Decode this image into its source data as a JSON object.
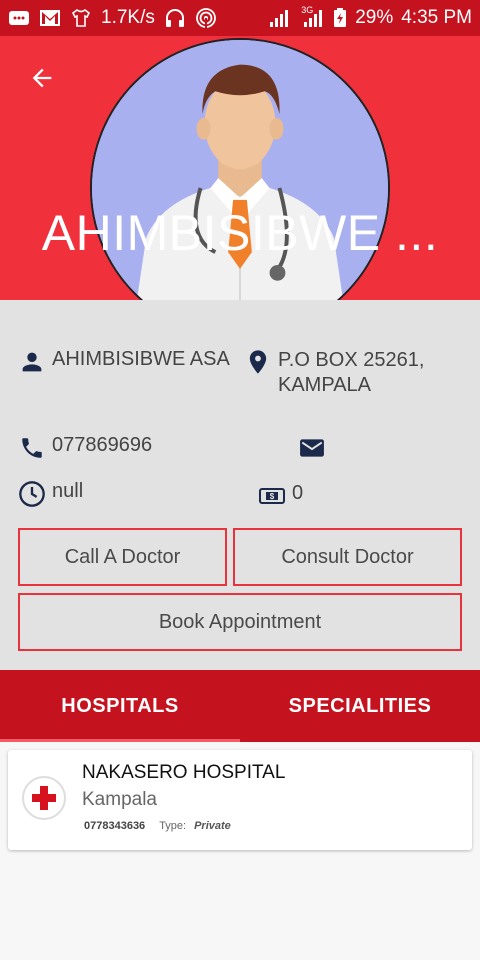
{
  "status_bar": {
    "speed": "1.7K/s",
    "network": "3G",
    "battery": "29%",
    "time": "4:35 PM"
  },
  "header": {
    "title": "AHIMBISIBWE ..."
  },
  "doctor": {
    "name": "AHIMBISIBWE ASA",
    "address_line1": "P.O BOX 25261,",
    "address_line2": "KAMPALA",
    "phone": "077869696",
    "hours": "null",
    "fee": "0"
  },
  "actions": {
    "call": "Call A Doctor",
    "consult": "Consult Doctor",
    "book": "Book Appointment"
  },
  "tabs": [
    {
      "label": "HOSPITALS",
      "active": true
    },
    {
      "label": "SPECIALITIES",
      "active": false
    }
  ],
  "hospitals": [
    {
      "name": "NAKASERO HOSPITAL",
      "city": "Kampala",
      "phone": "0778343636",
      "type_label": "Type:",
      "type": "Private"
    }
  ],
  "colors": {
    "status_bar": "#c4121f",
    "header": "#f0313c",
    "tabs": "#c4121f",
    "button_border": "#e8333d",
    "info_bg": "#e2e2e2"
  }
}
